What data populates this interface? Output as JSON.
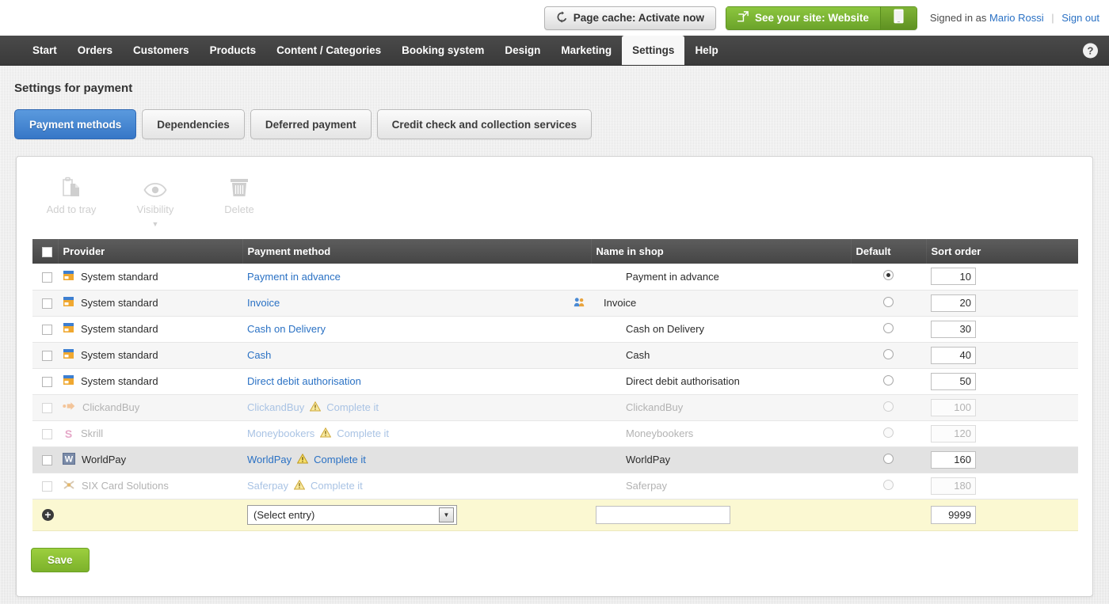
{
  "topbar": {
    "cache_button": "Page cache: Activate now",
    "site_button": "See your site: Website",
    "mobile_icon": "mobile-phone-icon",
    "signed_in_prefix": "Signed in as",
    "user_name": "Mario Rossi",
    "separator": "|",
    "sign_out": "Sign out"
  },
  "nav": {
    "items": [
      {
        "label": "Start",
        "active": false
      },
      {
        "label": "Orders",
        "active": false
      },
      {
        "label": "Customers",
        "active": false
      },
      {
        "label": "Products",
        "active": false
      },
      {
        "label": "Content / Categories",
        "active": false
      },
      {
        "label": "Booking system",
        "active": false
      },
      {
        "label": "Design",
        "active": false
      },
      {
        "label": "Marketing",
        "active": false
      },
      {
        "label": "Settings",
        "active": true
      },
      {
        "label": "Help",
        "active": false
      }
    ],
    "help_button": "?"
  },
  "page": {
    "title": "Settings for payment",
    "tabs": [
      {
        "label": "Payment methods",
        "active": true
      },
      {
        "label": "Dependencies",
        "active": false
      },
      {
        "label": "Deferred payment",
        "active": false
      },
      {
        "label": "Credit check and collection services",
        "active": false
      }
    ]
  },
  "toolbar": {
    "items": [
      {
        "label": "Add to tray",
        "icon": "clipboard-add-icon",
        "caret": false
      },
      {
        "label": "Visibility",
        "icon": "eye-icon",
        "caret": true,
        "caret_glyph": "▼"
      },
      {
        "label": "Delete",
        "icon": "trash-icon",
        "caret": false
      }
    ]
  },
  "table": {
    "columns": [
      "Provider",
      "Payment method",
      "Name in shop",
      "Default",
      "Sort order"
    ],
    "rows": [
      {
        "provider": "System standard",
        "provider_icon": "payment-card-icon",
        "method": "Payment in advance",
        "warning": "",
        "name_in_shop": "Payment in advance",
        "group_icon": false,
        "default": true,
        "sort": "10",
        "disabled": false,
        "alt": false,
        "hover": false
      },
      {
        "provider": "System standard",
        "provider_icon": "payment-card-icon",
        "method": "Invoice",
        "warning": "",
        "name_in_shop": "Invoice",
        "group_icon": true,
        "default": false,
        "sort": "20",
        "disabled": false,
        "alt": true,
        "hover": false
      },
      {
        "provider": "System standard",
        "provider_icon": "payment-card-icon",
        "method": "Cash on Delivery",
        "warning": "",
        "name_in_shop": "Cash on Delivery",
        "group_icon": false,
        "default": false,
        "sort": "30",
        "disabled": false,
        "alt": false,
        "hover": false
      },
      {
        "provider": "System standard",
        "provider_icon": "payment-card-icon",
        "method": "Cash",
        "warning": "",
        "name_in_shop": "Cash",
        "group_icon": false,
        "default": false,
        "sort": "40",
        "disabled": false,
        "alt": true,
        "hover": false
      },
      {
        "provider": "System standard",
        "provider_icon": "payment-card-icon",
        "method": "Direct debit authorisation",
        "warning": "",
        "name_in_shop": "Direct debit authorisation",
        "group_icon": false,
        "default": false,
        "sort": "50",
        "disabled": false,
        "alt": false,
        "hover": false
      },
      {
        "provider": "ClickandBuy",
        "provider_icon": "clickandbuy-arrow-icon",
        "method": "ClickandBuy",
        "warning": "Complete it",
        "name_in_shop": "ClickandBuy",
        "group_icon": false,
        "default": false,
        "sort": "100",
        "disabled": true,
        "alt": true,
        "hover": false
      },
      {
        "provider": "Skrill",
        "provider_icon": "skrill-s-icon",
        "method": "Moneybookers",
        "warning": "Complete it",
        "name_in_shop": "Moneybookers",
        "group_icon": false,
        "default": false,
        "sort": "120",
        "disabled": true,
        "alt": false,
        "hover": false
      },
      {
        "provider": "WorldPay",
        "provider_icon": "worldpay-w-icon",
        "method": "WorldPay",
        "warning": "Complete it",
        "name_in_shop": "WorldPay",
        "group_icon": false,
        "default": false,
        "sort": "160",
        "disabled": false,
        "alt": false,
        "hover": true
      },
      {
        "provider": "SIX Card Solutions",
        "provider_icon": "six-card-icon",
        "method": "Saferpay",
        "warning": "Complete it",
        "name_in_shop": "Saferpay",
        "group_icon": false,
        "default": false,
        "sort": "180",
        "disabled": true,
        "alt": false,
        "hover": false
      }
    ],
    "new_row": {
      "add_icon": "plus-circle-icon",
      "select_value": "(Select entry)",
      "name_value": "",
      "name_placeholder": "",
      "sort_value": "9999"
    }
  },
  "footer": {
    "save_label": "Save"
  }
}
